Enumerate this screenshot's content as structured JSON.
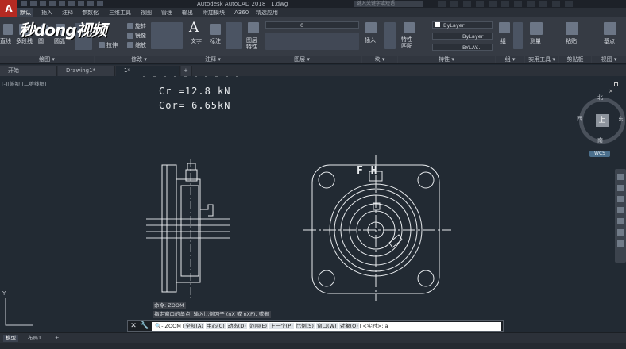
{
  "app": {
    "title": "Autodesk AutoCAD 2018",
    "file": "1.dwg",
    "search_placeholder": "键入关键字或短语"
  },
  "ribbon_tabs": [
    "默认",
    "插入",
    "注释",
    "参数化",
    "三维工具",
    "视图",
    "管理",
    "输出",
    "附加模块",
    "A360",
    "精选应用"
  ],
  "ribbon": {
    "draw": {
      "line": "直线",
      "polyline": "多段线",
      "circle": "圆",
      "arc": "圆弧",
      "panel": "绘图"
    },
    "modify": {
      "rotate": "旋转",
      "mirror": "镜像",
      "stretch": "拉伸",
      "scale": "缩放",
      "panel": "修改"
    },
    "annotation": {
      "text": "文字",
      "dimension": "标注",
      "panel": "注释"
    },
    "layers": {
      "layer_props": "图层特性",
      "current_layer": "0",
      "panel": "图层"
    },
    "block": {
      "insert": "插入",
      "panel": "块"
    },
    "properties": {
      "match": "特性匹配",
      "color": "ByLayer",
      "linetype": "ByLayer",
      "lineweight": "BYLAY...",
      "panel": "特性"
    },
    "groups": {
      "group": "组",
      "panel": "组"
    },
    "utilities": {
      "measure": "测量",
      "panel": "实用工具"
    },
    "clipboard": {
      "paste": "粘贴",
      "panel": "剪贴板"
    },
    "base": {
      "base": "基点"
    },
    "view": {
      "panel": "视图"
    }
  },
  "watermark": "秒dong视频",
  "doc_tabs": [
    "开始",
    "Drawing1*",
    "1*"
  ],
  "viewport_label": "[-][俯视][二维线框]",
  "drawing_text": {
    "cr": "Cr =12.8  kN",
    "cor": "Cor=  6.65kN",
    "logo": "F H"
  },
  "viewcube": {
    "north": "北",
    "south": "南",
    "west": "西",
    "east": "东",
    "face": "上",
    "wcs": "WCS"
  },
  "command": {
    "history_1": "命令: ZOOM",
    "history_2": "指定窗口的角点, 输入比例因子 (nX 或 nXP), 或者",
    "prompt_prefix": "ZOOM",
    "options": [
      "全部(A)",
      "中心(C)",
      "动态(D)",
      "范围(E)",
      "上一个(P)",
      "比例(S)",
      "窗口(W)",
      "对象(O)"
    ],
    "prompt_suffix": "<实时>:",
    "value": "a"
  },
  "status_tabs": [
    "模型",
    "布局1"
  ],
  "colors": {
    "accent": "#b52a22",
    "canvas": "#222a33",
    "lines": "#e8ebee"
  }
}
